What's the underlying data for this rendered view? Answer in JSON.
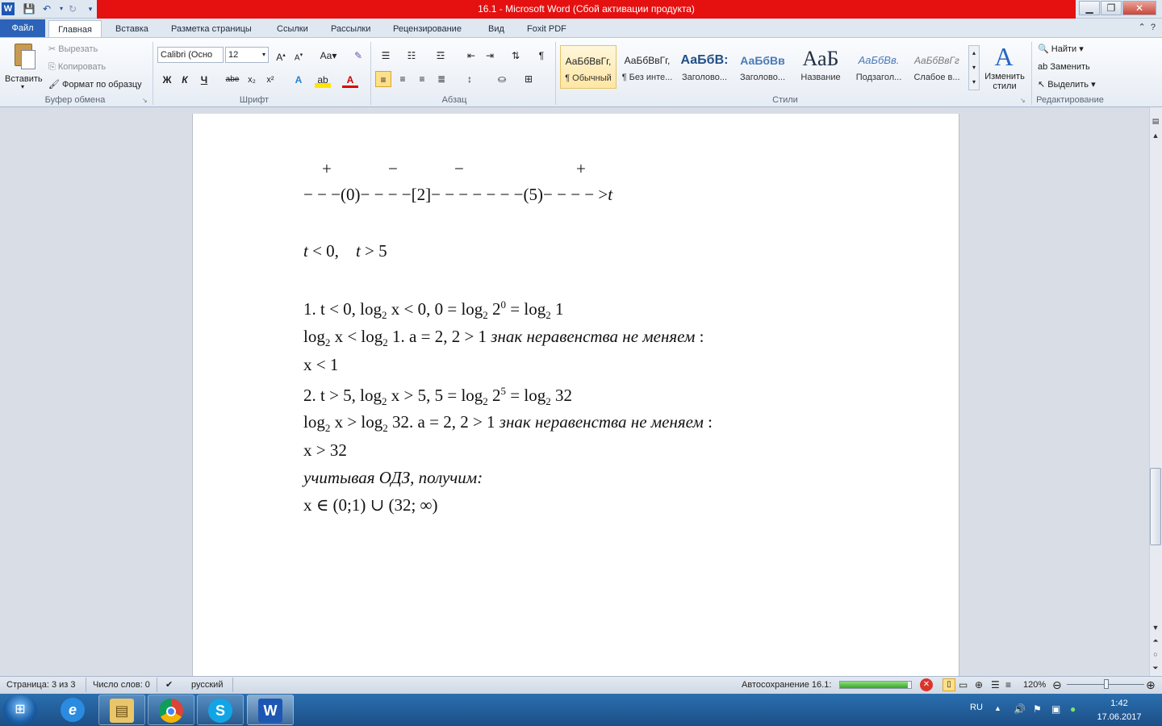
{
  "window": {
    "title": "16.1  -  Microsoft Word (Сбой активации продукта)"
  },
  "ribbon": {
    "tabs": [
      {
        "label": "Файл"
      },
      {
        "label": "Главная"
      },
      {
        "label": "Вставка"
      },
      {
        "label": "Разметка страницы"
      },
      {
        "label": "Ссылки"
      },
      {
        "label": "Рассылки"
      },
      {
        "label": "Рецензирование"
      },
      {
        "label": "Вид"
      },
      {
        "label": "Foxit PDF"
      }
    ],
    "clipboard": {
      "paste": "Вставить",
      "cut": "Вырезать",
      "copy": "Копировать",
      "format_painter": "Формат по образцу",
      "label": "Буфер обмена"
    },
    "font": {
      "name": "Calibri (Осно",
      "size": "12",
      "label": "Шрифт",
      "bold": "Ж",
      "italic": "К",
      "underline": "Ч",
      "strike": "abe",
      "sub": "x₂",
      "sup": "x²"
    },
    "paragraph": {
      "label": "Абзац"
    },
    "styles": {
      "label": "Стили",
      "items": [
        {
          "sample": "АаБбВвГг,",
          "name": "¶ Обычный"
        },
        {
          "sample": "АаБбВвГг,",
          "name": "¶ Без инте..."
        },
        {
          "sample": "АаБбВ:",
          "name": "Заголово..."
        },
        {
          "sample": "АаБбВв",
          "name": "Заголово..."
        },
        {
          "sample": "АаБ",
          "name": "Название"
        },
        {
          "sample": "АаБбВв.",
          "name": "Подзагол..."
        },
        {
          "sample": "АаБбВвГг",
          "name": "Слабое в..."
        }
      ],
      "change": "Изменить стили"
    },
    "editing": {
      "label": "Редактирование",
      "find": "Найти",
      "replace": "Заменить",
      "select": "Выделить"
    }
  },
  "document": {
    "sign_plus1": "+",
    "sign_minus1": "−",
    "sign_minus2": "−",
    "sign_plus2": "+",
    "number_line": "− − −(0)− − − −[2]− − − − − − −(5)− − − − >",
    "number_line_var": "t",
    "line_t_lt0": "t",
    "line_t_lt0_rest": " < 0,",
    "line_t_gt5": "t",
    "line_t_gt5_rest": " > 5",
    "case1_line1": "1.    t < 0,    log",
    "case1_line1_b": "x < 0,    0 = log",
    "case1_line1_c": "2",
    "case1_line1_d": " = log",
    "case1_line1_e": " 1",
    "case1_line2_a": "log",
    "case1_line2_b": " x < log",
    "case1_line2_c": " 1.    a = 2,    2 > 1 ",
    "case1_line2_note": "знак неравенства не меняем",
    "case1_result": "x < 1",
    "case2_line1": "2.    t > 5,    log",
    "case2_line1_b": "x > 5,    5 = log",
    "case2_line1_c": "2",
    "case2_line1_d": " = log",
    "case2_line1_e": " 32",
    "case2_line2_a": "log",
    "case2_line2_b": " x > log",
    "case2_line2_c": " 32.    a = 2,    2 > 1 ",
    "case2_line2_note": "знак неравенства не меняем",
    "case2_result": "x > 32",
    "odz_line": "учитывая ОДЗ, получим:",
    "answer": "x ∈ (0;1) ∪ (32; ∞)",
    "sub2": "2",
    "exp0": "0",
    "exp5": "5",
    "colon": " :"
  },
  "statusbar": {
    "page": "Страница: 3 из 3",
    "words": "Число слов: 0",
    "language": "русский",
    "autosave": "Автосохранение 16.1:",
    "autosave_progress": 0.96,
    "zoom": "120%"
  },
  "taskbar": {
    "lang": "RU",
    "time": "1:42",
    "date": "17.06.2017"
  },
  "colors": {
    "title_red": "#e51010",
    "file_tab": "#2c63b8",
    "taskbar": "#1c4f86"
  }
}
